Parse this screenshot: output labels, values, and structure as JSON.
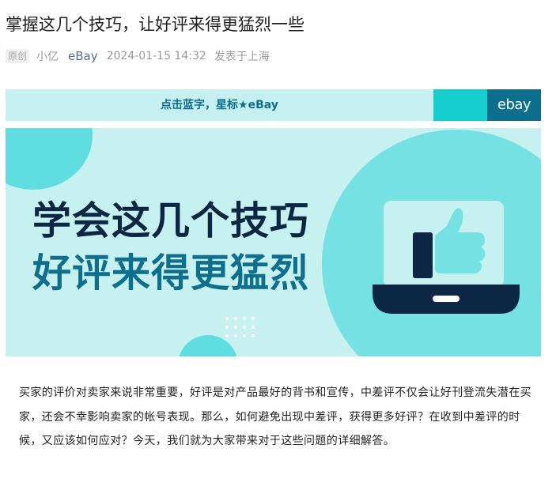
{
  "article": {
    "title": "掌握这几个技巧，让好评来得更猛烈一些",
    "original_tag": "原创",
    "author": "小亿",
    "account": "eBay",
    "date": "2024-01-15 14:32",
    "location": "发表于上海"
  },
  "follow_bar": {
    "text": "点击蓝字，星标★eBay",
    "logo": "ebay"
  },
  "banner": {
    "line1": "学会这几个技巧",
    "line2": "好评来得更猛烈",
    "icon": "thumbs-up-laptop-icon",
    "colors": {
      "background": "#c7f1f1",
      "accent": "#76e1e3",
      "dark": "#0b2743",
      "teal": "#0e6e8e"
    }
  },
  "body": {
    "paragraph": "买家的评价对卖家来说非常重要，好评是对产品最好的背书和宣传，中差评不仅会让好刊登流失潜在买家，还会不幸影响卖家的帐号表现。那么，如何避免出现中差评，获得更多好评？在收到中差评的时候，又应该如何应对？今天，我们就为大家带来对于这些问题的详细解答。"
  }
}
